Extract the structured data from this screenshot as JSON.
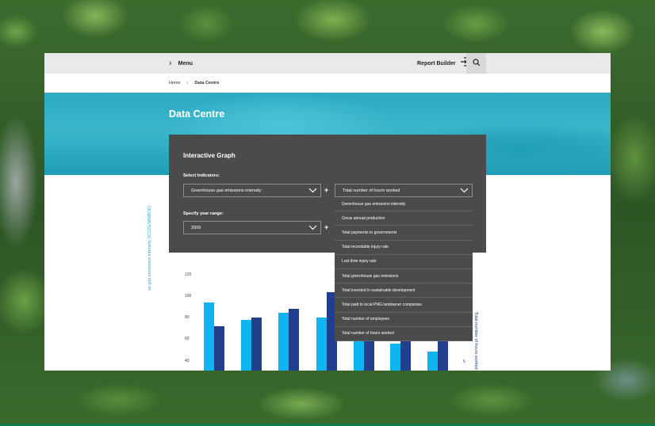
{
  "topbar": {
    "menu_label": "Menu",
    "report_builder_label": "Report Builder"
  },
  "breadcrumb": {
    "home": "Home",
    "separator": "›",
    "current": "Data Centre"
  },
  "hero": {
    "title": "Data Centre"
  },
  "panel": {
    "title": "Interactive Graph",
    "indicators_label": "Select Indicators:",
    "indicator_1": "Greenhouse gas emissions intensity",
    "indicator_2": "Total number of hours worked",
    "year_label": "Specify year range:",
    "year_from": "2009",
    "plus": "+"
  },
  "dropdown": {
    "options": [
      "Greenhouse gas emissions intensity",
      "Gross annual production",
      "Total payments to governments",
      "Total recordable injury rate",
      "Lost time injury rate",
      "Total greenhouse gas emissions",
      "Total invested in sustainable development",
      "Total paid to local PNG landowner companies",
      "Total number of employees",
      "Total number of hours worked"
    ]
  },
  "chart_data": {
    "type": "bar",
    "y_ticks": [
      "120",
      "100",
      "80",
      "60",
      "40"
    ],
    "right_tick": "5",
    "ylabel_left": "se gas emissions intensity (tCO2e/MMBOE)",
    "ylabel_right": "Total number of hours worked",
    "ylim": [
      35,
      120
    ],
    "colors": {
      "series_1": "#0db4f0",
      "series_2": "#213f8a"
    },
    "series": [
      {
        "values": [
          94,
          78,
          85,
          80,
          76,
          56,
          49
        ]
      },
      {
        "values": [
          72,
          80,
          88,
          104,
          60,
          64,
          62
        ]
      }
    ]
  }
}
